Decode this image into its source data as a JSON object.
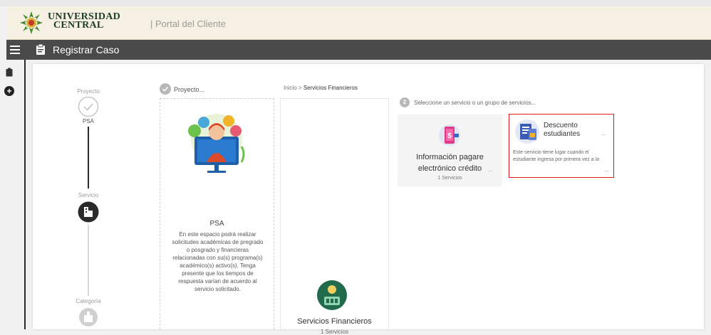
{
  "header": {
    "university_name_line1": "UNIVERSIDAD",
    "university_name_line2": "CENTRAL",
    "portal_title": "| Portal del Cliente"
  },
  "command_bar": {
    "title": "Registrar Caso"
  },
  "stepper": {
    "steps": [
      {
        "label": "Proyecto",
        "value": "PSA"
      },
      {
        "label": "Servicio",
        "value": ""
      },
      {
        "label": "Categoría",
        "value": ""
      }
    ]
  },
  "project_panel": {
    "header": "Proyecto...",
    "card_title": "PSA",
    "card_description": "En este espacio podrá realizar solicitudes académicas de pregrado o posgrado y financieras relacionadas con su(s) programa(s) académico(s) activo(s). Tenga presente que los tiempos de respuesta varían de acuerdo al servicio solicitado."
  },
  "category_panel": {
    "breadcrumb_root": "Inicio",
    "breadcrumb_separator": ">",
    "breadcrumb_current": "Servicios Financieros",
    "card_title": "Servicios Financieros",
    "card_count": "1 Servicios"
  },
  "services_panel": {
    "step_number": "2",
    "hint": "Seleccione un servicio o un grupo de servicios...",
    "services": [
      {
        "title_line1": "Información pagare",
        "title_line2": "electrónico crédito",
        "more": "...",
        "count": "1 Servicios"
      },
      {
        "title_line1": "Descuento",
        "title_line2": "estudiantes",
        "more": "...",
        "description": "Este servicio tiene lugar cuando el estudiante ingresa por primera vez a la",
        "more_bottom": "..."
      }
    ]
  },
  "colors": {
    "command_bar": "#4a4a4a",
    "brand_bar": "#f6f0e2",
    "selected_border": "#e0191b",
    "step_active": "#2a2a2a",
    "step_inactive": "#c8c8c8"
  }
}
